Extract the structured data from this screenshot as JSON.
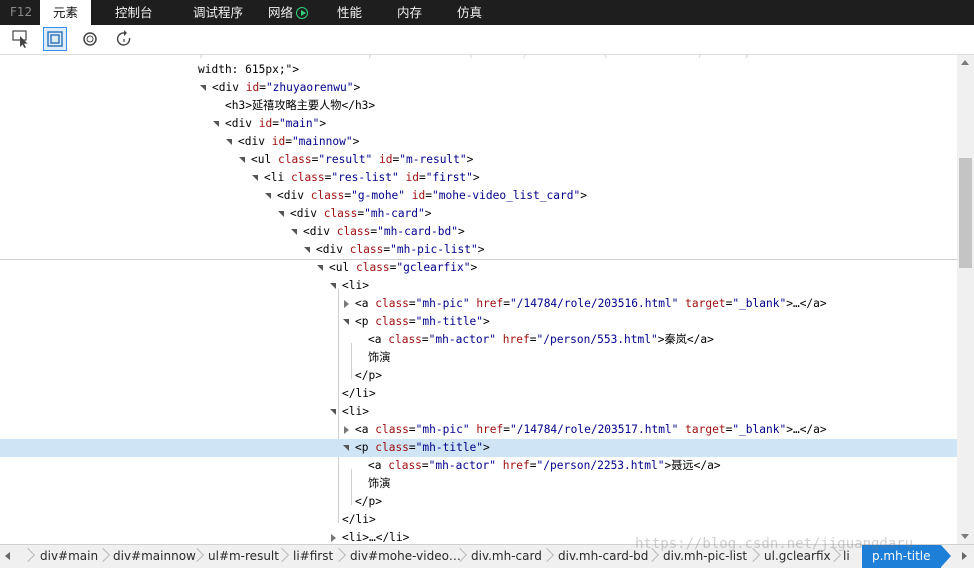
{
  "tabs": {
    "f12": "F12",
    "elements": "元素",
    "console": "控制台",
    "debugger": "调试程序",
    "network": "网络",
    "performance": "性能",
    "memory": "内存",
    "emulation": "仿真"
  },
  "toolbar_icons": [
    "select-element-icon",
    "highlight-box-icon",
    "circle-icon",
    "refresh-timer-icon"
  ],
  "tree": {
    "rows": [
      {
        "faint": ";                        ;              (       )           (             )      ;"
      },
      {
        "text": "width: 615px;\">"
      },
      {
        "tag_open": "<div",
        "attrs": [
          {
            "name": "id",
            "value": "\"zhuyaorenwu\""
          }
        ],
        "close": ">"
      },
      {
        "tag_open": "<h3>",
        "text": "延禧攻略主要人物",
        "end": "</h3>"
      },
      {
        "tag_open": "<div",
        "attrs": [
          {
            "name": "id",
            "value": "\"main\""
          }
        ],
        "close": ">"
      },
      {
        "tag_open": "<div",
        "attrs": [
          {
            "name": "id",
            "value": "\"mainnow\""
          }
        ],
        "close": ">"
      },
      {
        "tag_open": "<ul",
        "attrs": [
          {
            "name": "class",
            "value": "\"result\""
          },
          {
            "name": "id",
            "value": "\"m-result\""
          }
        ],
        "close": ">"
      },
      {
        "tag_open": "<li",
        "attrs": [
          {
            "name": "class",
            "value": "\"res-list\""
          },
          {
            "name": "id",
            "value": "\"first\""
          }
        ],
        "close": ">"
      },
      {
        "tag_open": "<div",
        "attrs": [
          {
            "name": "class",
            "value": "\"g-mohe\""
          },
          {
            "name": "id",
            "value": "\"mohe-video_list_card\""
          }
        ],
        "close": ">"
      },
      {
        "tag_open": "<div",
        "attrs": [
          {
            "name": "class",
            "value": "\"mh-card\""
          }
        ],
        "close": ">"
      },
      {
        "tag_open": "<div",
        "attrs": [
          {
            "name": "class",
            "value": "\"mh-card-bd\""
          }
        ],
        "close": ">"
      },
      {
        "tag_open": "<div",
        "attrs": [
          {
            "name": "class",
            "value": "\"mh-pic-list\""
          }
        ],
        "close": ">"
      },
      {
        "tag_open": "<ul",
        "attrs": [
          {
            "name": "class",
            "value": "\"gclearfix\""
          }
        ],
        "close": ">"
      },
      {
        "tag_open": "<li>"
      },
      {
        "tag_open": "<a",
        "attrs": [
          {
            "name": "class",
            "value": "\"mh-pic\""
          },
          {
            "name": "href",
            "value": "\"/14784/role/203516.html\""
          },
          {
            "name": "target",
            "value": "\"_blank\""
          }
        ],
        "close": ">…</a>"
      },
      {
        "tag_open": "<p",
        "attrs": [
          {
            "name": "class",
            "value": "\"mh-title\""
          }
        ],
        "close": ">"
      },
      {
        "tag_open": "<a",
        "attrs": [
          {
            "name": "class",
            "value": "\"mh-actor\""
          },
          {
            "name": "href",
            "value": "\"/person/553.html\""
          }
        ],
        "close": ">",
        "text": "秦岚",
        "end": "</a>"
      },
      {
        "text": "饰演"
      },
      {
        "tag_open": "</p>"
      },
      {
        "tag_open": "</li>"
      },
      {
        "tag_open": "<li>"
      },
      {
        "tag_open": "<a",
        "attrs": [
          {
            "name": "class",
            "value": "\"mh-pic\""
          },
          {
            "name": "href",
            "value": "\"/14784/role/203517.html\""
          },
          {
            "name": "target",
            "value": "\"_blank\""
          }
        ],
        "close": ">…</a>"
      },
      {
        "tag_open": "<p",
        "attrs": [
          {
            "name": "class",
            "value": "\"mh-title\""
          }
        ],
        "close": ">"
      },
      {
        "tag_open": "<a",
        "attrs": [
          {
            "name": "class",
            "value": "\"mh-actor\""
          },
          {
            "name": "href",
            "value": "\"/person/2253.html\""
          }
        ],
        "close": ">",
        "text": "聂远",
        "end": "</a>"
      },
      {
        "text": "饰演"
      },
      {
        "tag_open": "</p>"
      },
      {
        "tag_open": "</li>"
      },
      {
        "tag_open": "<li>",
        "text": "…",
        "end": "</li>"
      }
    ]
  },
  "breadcrumb": [
    "div#main",
    "div#mainnow",
    "ul#m-result",
    "li#first",
    "div#mohe-video…",
    "div.mh-card",
    "div.mh-card-bd",
    "div.mh-pic-list",
    "ul.gclearfix",
    "li",
    "p.mh-title"
  ],
  "watermark": "https://blog.csdn.net/jiguangdaru",
  "colors": {
    "tag": "#000000",
    "attr_name": "#a01010",
    "attr_value": "#00008b",
    "selected_row": "#cfe4f4",
    "active_crumb": "#1e7fd8",
    "network_icon": "#2fd07a"
  }
}
